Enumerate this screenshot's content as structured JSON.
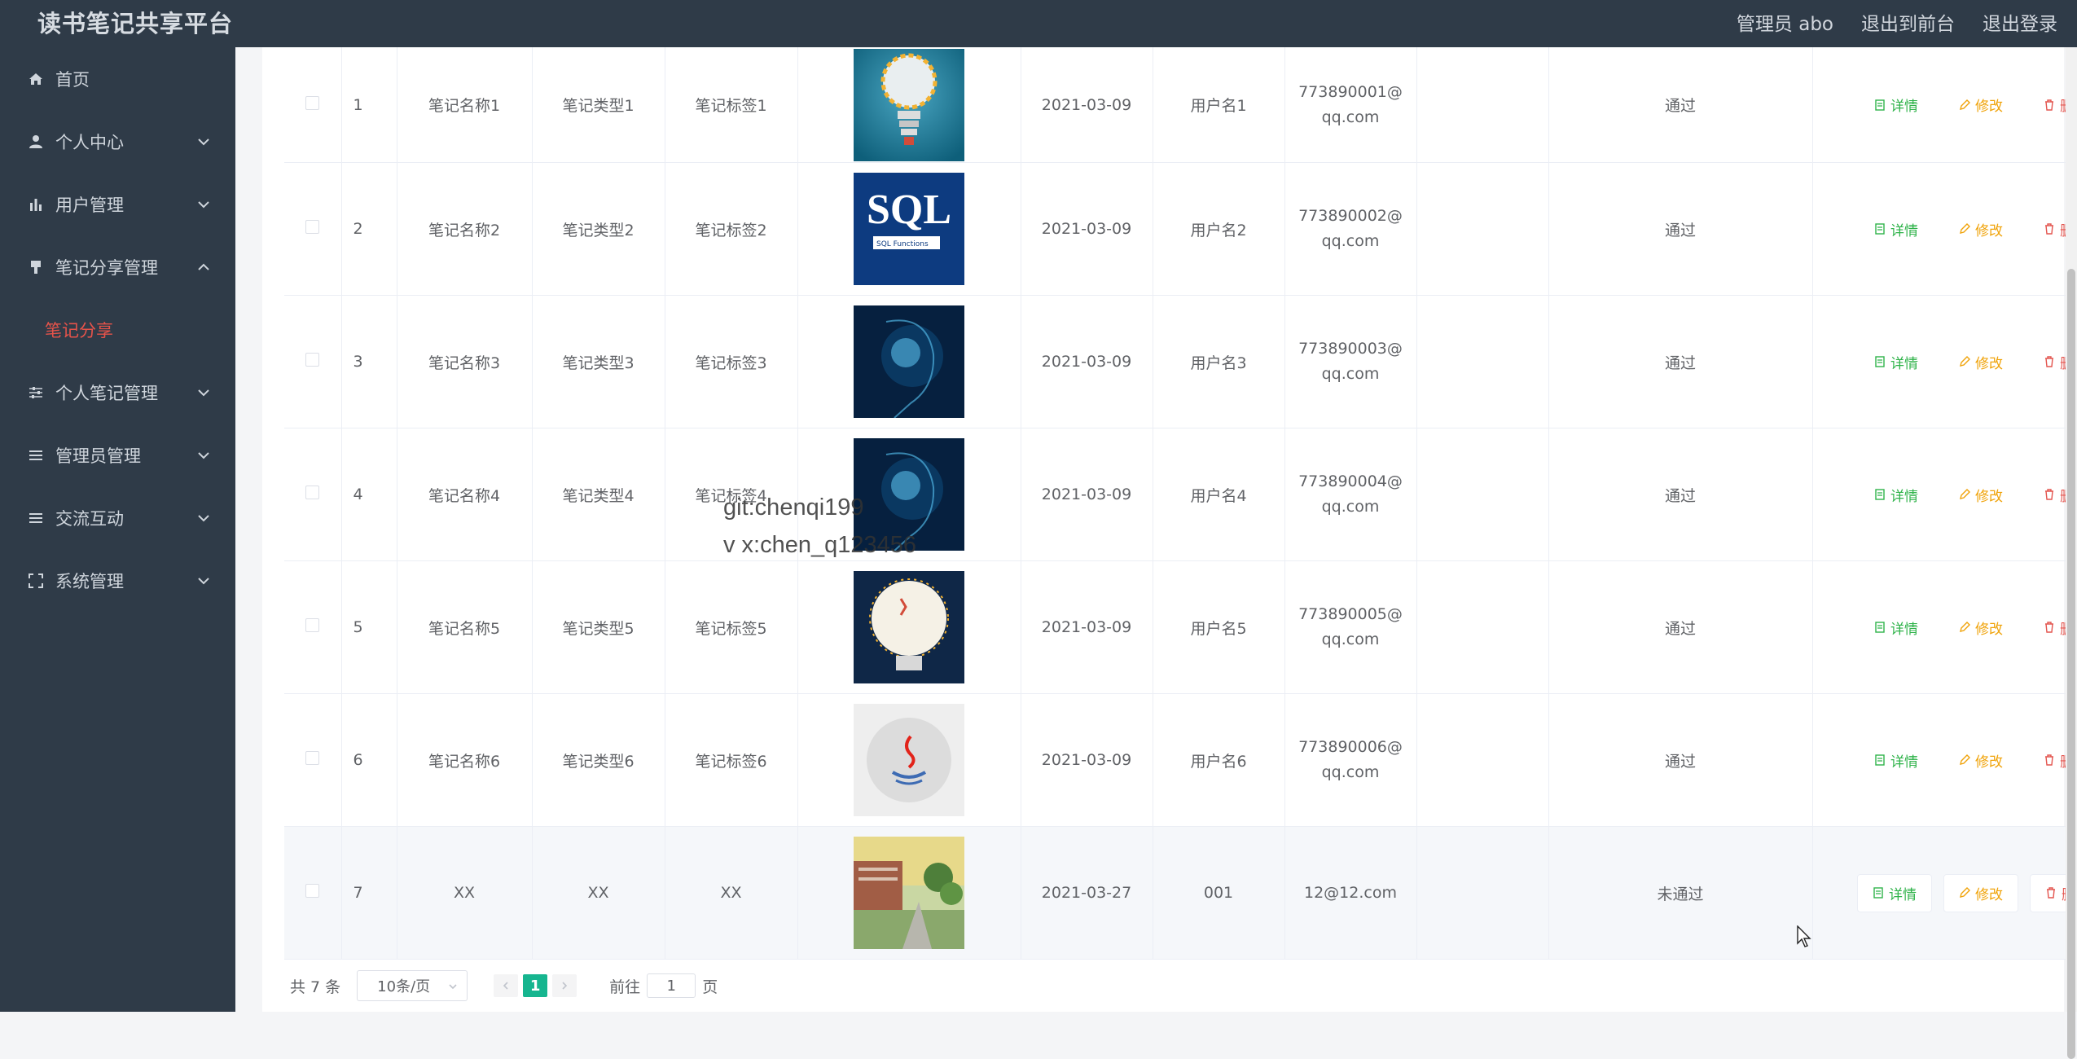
{
  "header": {
    "brand": "读书笔记共享平台",
    "admin": "管理员 abo",
    "to_frontend": "退出到前台",
    "logout": "退出登录"
  },
  "sidebar": {
    "items": [
      {
        "label": "首页",
        "icon": "home-icon"
      },
      {
        "label": "个人中心",
        "icon": "user-icon"
      },
      {
        "label": "用户管理",
        "icon": "bar-chart-icon"
      },
      {
        "label": "笔记分享管理",
        "icon": "brush-icon"
      },
      {
        "label": "个人笔记管理",
        "icon": "sliders-icon"
      },
      {
        "label": "管理员管理",
        "icon": "list-icon"
      },
      {
        "label": "交流互动",
        "icon": "list-icon"
      },
      {
        "label": "系统管理",
        "icon": "fullscreen-icon"
      }
    ],
    "active_sub": "笔记分享"
  },
  "table": {
    "rows": [
      {
        "idx": "1",
        "name": "笔记名称1",
        "type": "笔记类型1",
        "tag": "笔记标签1",
        "image": "idea-lightbulb",
        "date": "2021-03-09",
        "user": "用户名1",
        "email_l1": "773890001@",
        "email_l2": "qq.com",
        "status": "通过"
      },
      {
        "idx": "2",
        "name": "笔记名称2",
        "type": "笔记类型2",
        "tag": "笔记标签2",
        "image": "sql-cover",
        "date": "2021-03-09",
        "user": "用户名2",
        "email_l1": "773890002@",
        "email_l2": "qq.com",
        "status": "通过"
      },
      {
        "idx": "3",
        "name": "笔记名称3",
        "type": "笔记类型3",
        "tag": "笔记标签3",
        "image": "ai-head",
        "date": "2021-03-09",
        "user": "用户名3",
        "email_l1": "773890003@",
        "email_l2": "qq.com",
        "status": "通过"
      },
      {
        "idx": "4",
        "name": "笔记名称4",
        "type": "笔记类型4",
        "tag": "笔记标签4",
        "image": "ai-head",
        "date": "2021-03-09",
        "user": "用户名4",
        "email_l1": "773890004@",
        "email_l2": "qq.com",
        "status": "通过"
      },
      {
        "idx": "5",
        "name": "笔记名称5",
        "type": "笔记类型5",
        "tag": "笔记标签5",
        "image": "lightbulb-infographic",
        "date": "2021-03-09",
        "user": "用户名5",
        "email_l1": "773890005@",
        "email_l2": "qq.com",
        "status": "通过"
      },
      {
        "idx": "6",
        "name": "笔记名称6",
        "type": "笔记类型6",
        "tag": "笔记标签6",
        "image": "java-logo",
        "date": "2021-03-09",
        "user": "用户名6",
        "email_l1": "773890006@",
        "email_l2": "qq.com",
        "status": "通过"
      },
      {
        "idx": "7",
        "name": "XX",
        "type": "XX",
        "tag": "XX",
        "image": "campus-photo",
        "date": "2021-03-27",
        "user": "001",
        "email_l1": "12@12.com",
        "email_l2": "",
        "status": "未通过"
      }
    ],
    "actions": {
      "detail": "详情",
      "edit": "修改",
      "delete": "删除"
    }
  },
  "pagination": {
    "total": "共 7 条",
    "page_size": "10条/页",
    "current_page": "1",
    "goto_prefix": "前往",
    "goto_value": "1",
    "goto_suffix": "页"
  },
  "watermark": {
    "line1": "git:chenqi199",
    "line2": "v x:chen_q123456"
  },
  "colors": {
    "sidebar_bg": "#2f3b48",
    "active_sub": "#e6534a",
    "page_active": "#16b58f",
    "detail": "#2fb34a",
    "edit": "#f0a30a",
    "delete": "#e3554f"
  }
}
